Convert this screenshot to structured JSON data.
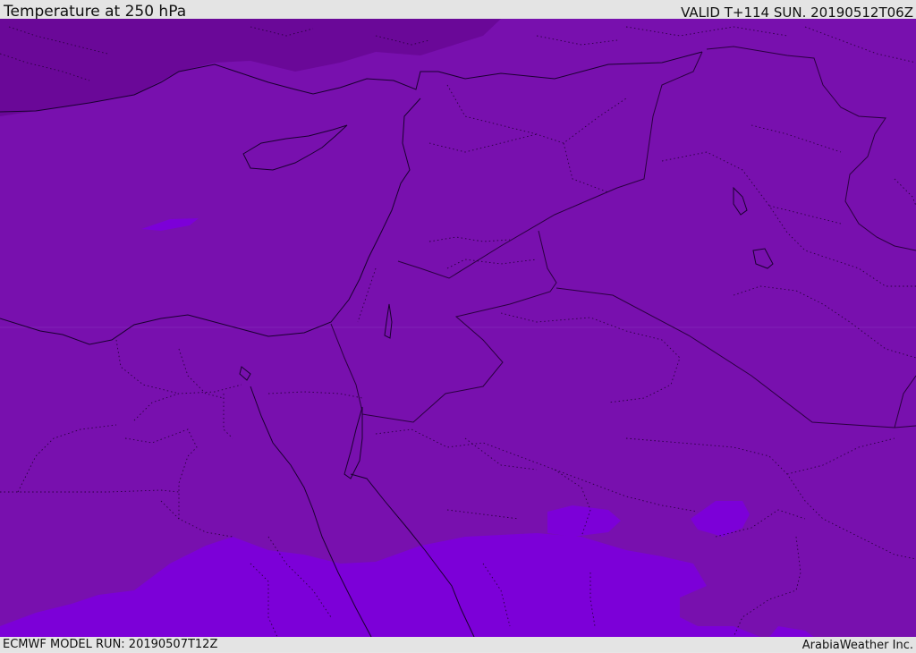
{
  "header": {
    "title": "Temperature at 250 hPa",
    "valid": "VALID T+114 SUN. 20190512T06Z"
  },
  "footer": {
    "model_run": "ECMWF MODEL RUN: 20190507T12Z",
    "credit": "ArabiaWeather Inc."
  },
  "map": {
    "colors": {
      "cold_region": "#6a0898",
      "base_region": "#7810ae",
      "warm_region": "#7c00d8",
      "coastline": "#1a0030",
      "border": "#2a0040"
    }
  }
}
